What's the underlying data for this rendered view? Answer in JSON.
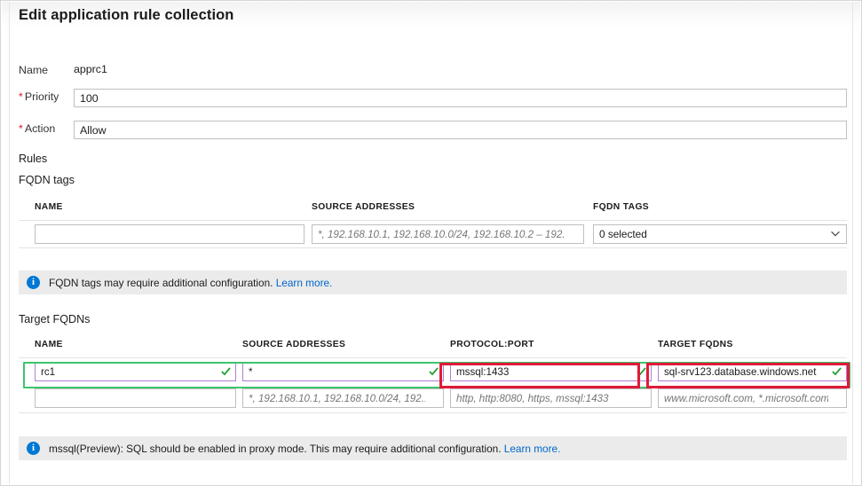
{
  "blade": {
    "title": "Edit application rule collection"
  },
  "form": {
    "name_label": "Name",
    "name_value": "apprc1",
    "priority_label": "Priority",
    "priority_value": "100",
    "action_label": "Action",
    "action_value": "Allow",
    "required_marker": "*"
  },
  "rules": {
    "section_label": "Rules",
    "fqdn_tags": {
      "title": "FQDN tags",
      "columns": [
        "NAME",
        "SOURCE ADDRESSES",
        "FQDN TAGS"
      ],
      "rows": [
        {
          "name": "",
          "name_placeholder": "",
          "source_addresses": "",
          "source_addresses_placeholder": "*, 192.168.10.1, 192.168.10.0/24, 192.168.10.2 – 192.168...",
          "fqdn_tags_selected": "0 selected"
        }
      ],
      "info": {
        "text": "FQDN tags may require additional configuration.",
        "link": "Learn more."
      }
    },
    "target_fqdns": {
      "title": "Target FQDNs",
      "columns": [
        "NAME",
        "SOURCE ADDRESSES",
        "PROTOCOL:PORT",
        "TARGET FQDNS"
      ],
      "rows": [
        {
          "name": "rc1",
          "source_addresses": "*",
          "protocol_port": "mssql:1433",
          "target_fqdns": "sql-srv123.database.windows.net",
          "validated": true,
          "highlighted": true
        },
        {
          "name": "",
          "name_placeholder": "",
          "source_addresses": "",
          "source_addresses_placeholder": "*, 192.168.10.1, 192.168.10.0/24, 192.16...",
          "protocol_port": "",
          "protocol_port_placeholder": "http, http:8080, https, mssql:1433",
          "target_fqdns": "",
          "target_fqdns_placeholder": "www.microsoft.com, *.microsoft.com",
          "validated": false,
          "highlighted": false
        }
      ],
      "info": {
        "text": "mssql(Preview): SQL should be enabled in proxy mode. This may require additional configuration.",
        "link": "Learn more."
      }
    }
  },
  "icons": {
    "info": "i",
    "valid_check": "check-icon",
    "chevron": "chevron-down-icon"
  },
  "colors": {
    "accent_link": "#0066cc",
    "required_star": "#e81123",
    "valid_check": "#1f9d2f",
    "valid_border": "#b07fd4",
    "annotation_red": "#e01b39",
    "row_highlight_green": "#3ec46d",
    "info_bar_bg": "#ebebeb",
    "info_icon_bg": "#0078d4"
  }
}
